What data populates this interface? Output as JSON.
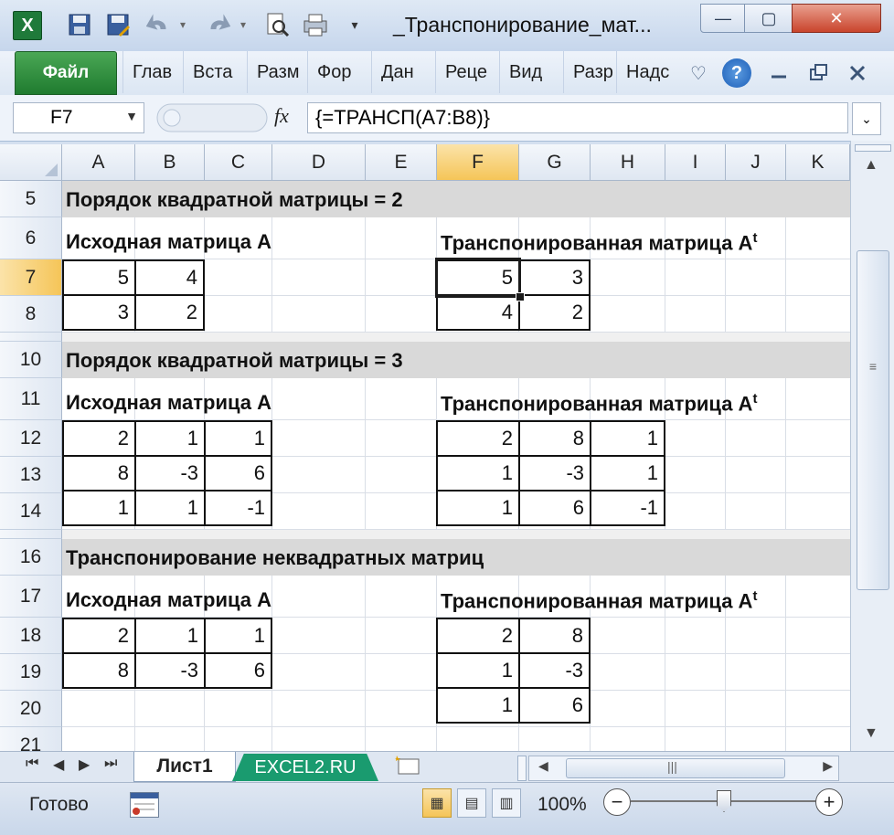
{
  "window": {
    "title": "_Транспонирование_мат...",
    "app_icon": "excel-logo",
    "app_letter": "X",
    "quick_access": [
      "save-icon",
      "save-as-icon",
      "undo-icon",
      "redo-icon",
      "print-preview-icon",
      "quick-print-icon",
      "customize-icon"
    ],
    "controls": {
      "minimize": "—",
      "maximize": "▢",
      "close": "✕"
    }
  },
  "ribbon": {
    "file_tab": "Файл",
    "tabs": [
      "Глав",
      "Вста",
      "Разм",
      "Фор",
      "Дан",
      "Реце",
      "Вид",
      "Разр",
      "Надс"
    ],
    "help_icon": "?",
    "heart_icon": "♡"
  },
  "formula_bar": {
    "name_box": "F7",
    "fx_label": "fx",
    "formula": "{=ТРАНСП(A7:B8)}"
  },
  "columns": [
    "A",
    "B",
    "C",
    "D",
    "E",
    "F",
    "G",
    "H",
    "I",
    "J",
    "K"
  ],
  "selected_column": "F",
  "selected_row": "7",
  "rows": [
    "5",
    "6",
    "7",
    "8",
    "10",
    "11",
    "12",
    "13",
    "14",
    "16",
    "17",
    "18",
    "19",
    "20",
    "21"
  ],
  "sections": {
    "s1": {
      "title": "Порядок квадратной матрицы = 2"
    },
    "s2": {
      "title": "Порядок квадратной матрицы = 3"
    },
    "s3": {
      "title": "Транспонирование неквадратных матриц"
    }
  },
  "labels": {
    "source": "Исходная матрица A",
    "transposed": "Транспонированная матрица A",
    "transposed_sup": "t"
  },
  "matrices": {
    "m1_src": [
      [
        "5",
        "4"
      ],
      [
        "3",
        "2"
      ]
    ],
    "m1_dst": [
      [
        "5",
        "3"
      ],
      [
        "4",
        "2"
      ]
    ],
    "m2_src": [
      [
        "2",
        "1",
        "1"
      ],
      [
        "8",
        "-3",
        "6"
      ],
      [
        "1",
        "1",
        "-1"
      ]
    ],
    "m2_dst": [
      [
        "2",
        "8",
        "1"
      ],
      [
        "1",
        "-3",
        "1"
      ],
      [
        "1",
        "6",
        "-1"
      ]
    ],
    "m3_src": [
      [
        "2",
        "1",
        "1"
      ],
      [
        "8",
        "-3",
        "6"
      ]
    ],
    "m3_dst": [
      [
        "2",
        "8"
      ],
      [
        "1",
        "-3"
      ],
      [
        "1",
        "6"
      ]
    ]
  },
  "sheet_tabs": {
    "active": "Лист1",
    "second": "EXCEL2.RU"
  },
  "status": {
    "ready": "Готово",
    "zoom": "100%",
    "zoom_minus": "−",
    "zoom_plus": "+"
  }
}
